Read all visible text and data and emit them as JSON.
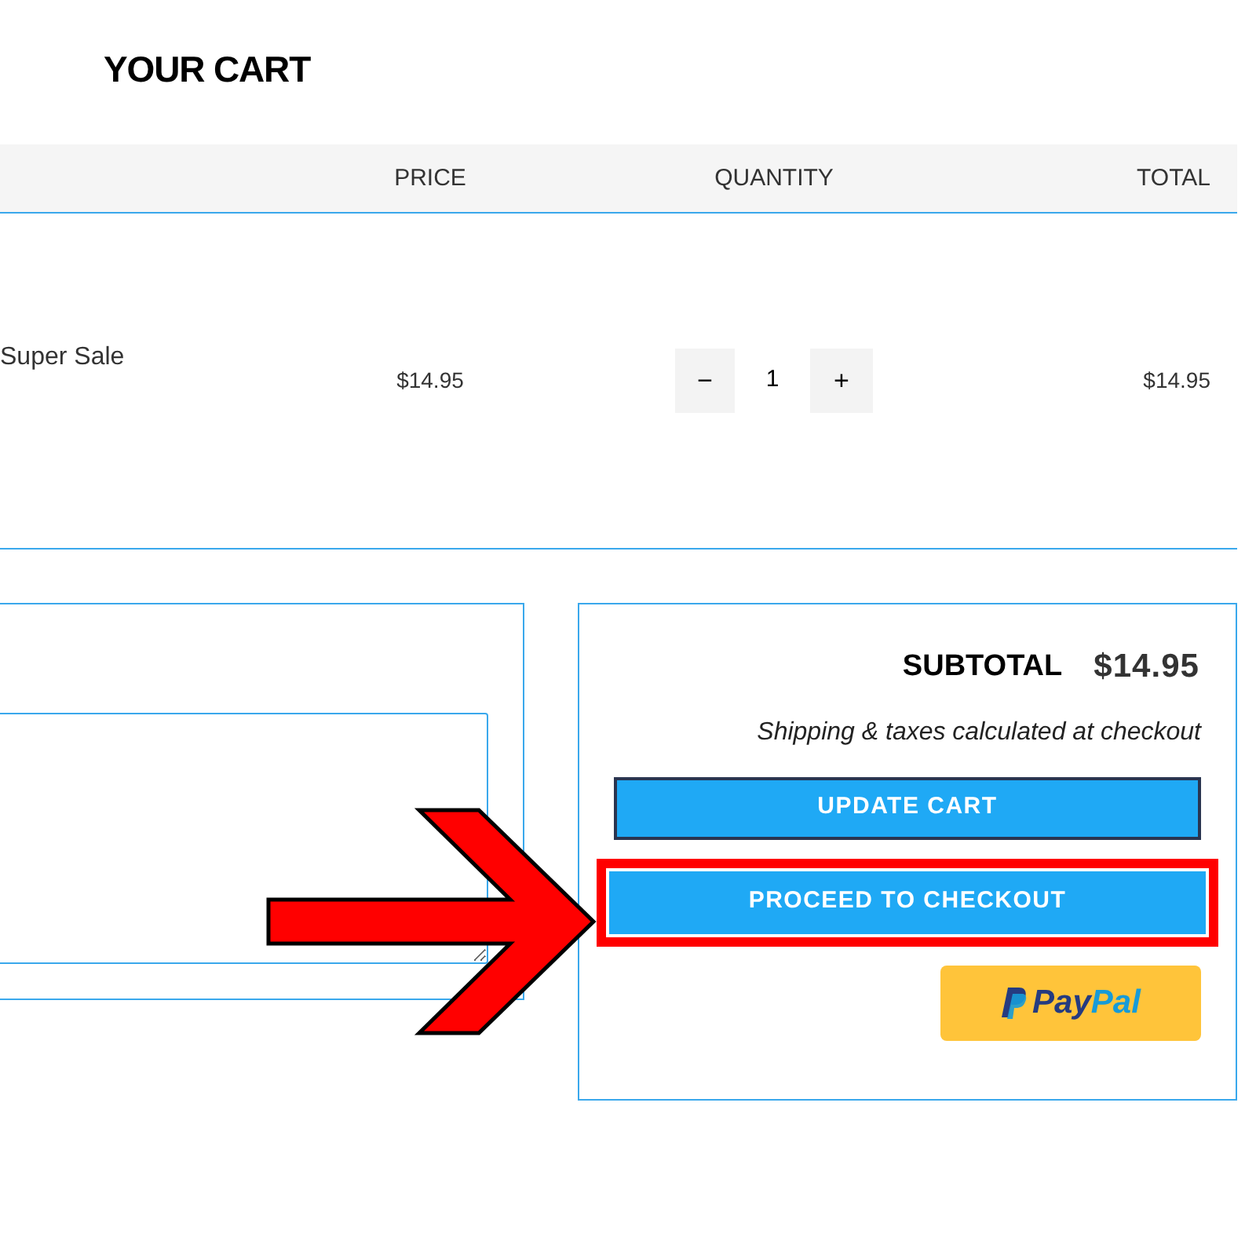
{
  "title": "YOUR CART",
  "table": {
    "columns": [
      "PRICE",
      "QUANTITY",
      "TOTAL"
    ],
    "rows": [
      {
        "product": "Super Sale",
        "price": "$14.95",
        "quantity": {
          "minus": "−",
          "value": "1",
          "plus": "+"
        },
        "total": "$14.95"
      }
    ]
  },
  "summary": {
    "subtotal_label": "SUBTOTAL",
    "subtotal": "$14.95",
    "note": "Shipping & taxes calculated at checkout",
    "buttons": [
      {
        "kind": "primary",
        "label": "UPDATE CART",
        "highlighted": false
      },
      {
        "kind": "primary",
        "label": "PROCEED TO CHECKOUT",
        "highlighted": true
      },
      {
        "kind": "paypal",
        "label_parts": [
          "Pay",
          "Pal"
        ],
        "highlighted": false
      }
    ]
  },
  "annotation": {
    "arrow": true
  }
}
